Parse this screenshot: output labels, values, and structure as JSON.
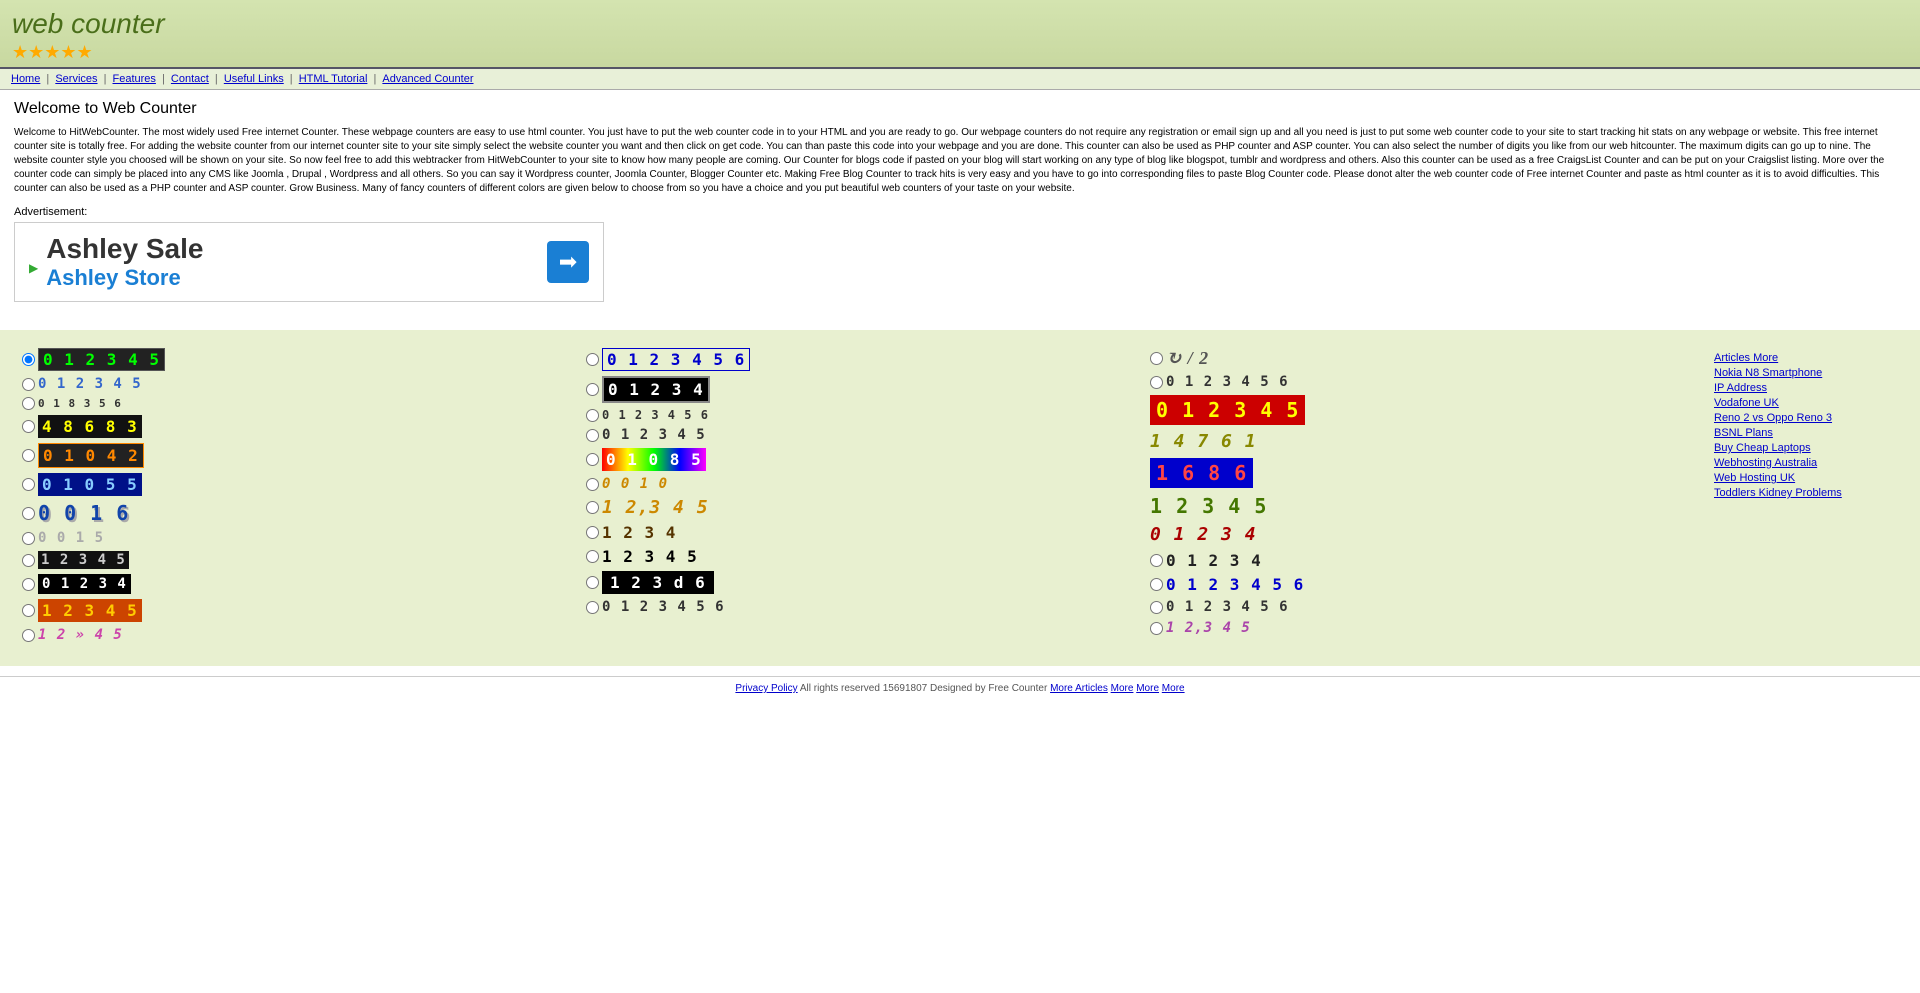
{
  "header": {
    "logo": "web counter",
    "stars": "★★★★★"
  },
  "nav": {
    "links": [
      {
        "label": "Home",
        "href": "#"
      },
      {
        "label": "Services",
        "href": "#"
      },
      {
        "label": "Features",
        "href": "#"
      },
      {
        "label": "Contact",
        "href": "#"
      },
      {
        "label": "Useful Links",
        "href": "#"
      },
      {
        "label": "HTML Tutorial",
        "href": "#"
      },
      {
        "label": "Advanced Counter",
        "href": "#"
      }
    ]
  },
  "page": {
    "title": "Welcome to Web Counter",
    "intro": "Welcome to HitWebCounter. The most widely used Free internet Counter. These webpage counters are easy to use html counter. You just have to put the web counter code in to your HTML and you are ready to go. Our webpage counters do not require any registration or email sign up and all you need is just to put some web counter code to your site to start tracking hit stats on any webpage or website. This free internet counter site is totally free. For adding the website counter from our internet counter site to your site simply select the website counter you want and then click on get code. You can than paste this code into your webpage and you are done. This counter can also be used as PHP counter and ASP counter. You can also select the number of digits you like from our web hitcounter. The maximum digits can go up to nine. The website counter style you choosed will be shown on your site. So now feel free to add this webtracker from HitWebCounter to your site to know how many people are coming. Our Counter for blogs code if pasted on your blog will start working on any type of blog like blogspot, tumblr and wordpress and others. Also this counter can be used as a free CraigsList Counter and can be put on your Craigslist listing. More over the counter code can simply be placed into any CMS like Joomla , Drupal , Wordpress and all others. So you can say it Wordpress counter, Joomla Counter, Blogger Counter etc. Making Free Blog Counter to track hits is very easy and you have to go into corresponding files to paste Blog Counter code. Please donot alter the web counter code of Free internet Counter and paste as html counter as it is to avoid difficulties. This counter can also be used as a PHP counter and ASP counter. Grow Business. Many of fancy counters of different colors are given below to choose from so you have a choice and you put beautiful web counters of your taste on your website."
  },
  "ad": {
    "label": "Advertisement:",
    "title": "Ashley Sale",
    "subtitle": "Ashley Store",
    "arrow": "➡"
  },
  "sidebar": {
    "links": [
      "Articles More",
      "Nokia N8 Smartphone",
      "IP Address",
      "Vodafone UK",
      "Reno 2 vs Oppo Reno 3",
      "BSNL Plans",
      "Buy Cheap Laptops",
      "Webhosting Australia",
      "Web Hosting UK",
      "Toddlers Kidney Problems"
    ]
  },
  "footer": {
    "privacy": "Privacy Policy",
    "rights": "All rights reserved",
    "counter_val": "15691807",
    "designed": "Designed by Free Counter",
    "more_links": [
      "More Articles",
      "More",
      "More",
      "More"
    ]
  }
}
